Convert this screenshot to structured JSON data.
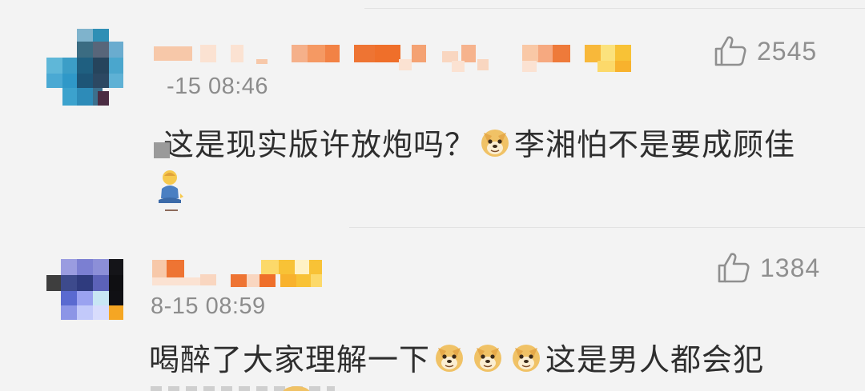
{
  "comments": [
    {
      "time": "-15 08:46",
      "likes": "2545",
      "text_before_emoji": "这是现实版许放炮吗？",
      "text_after_emoji": "李湘怕不是要成顾佳"
    },
    {
      "time": "8-15 08:59",
      "likes": "1384",
      "text_before_emoji": "喝醉了大家理解一下",
      "text_after_emoji": "这是男人都会犯"
    }
  ],
  "icons": {
    "like": "thumbs-up-icon",
    "doge": "doge-emoji-icon",
    "person": "meditating-person-emoji-icon"
  },
  "colors": {
    "background": "#f3f3f3",
    "text": "#2e2e2e",
    "meta": "#8c8c8c",
    "username_orange": "#ee7433",
    "username_peach": "#f7c8a9",
    "username_yellow": "#f8c236"
  }
}
